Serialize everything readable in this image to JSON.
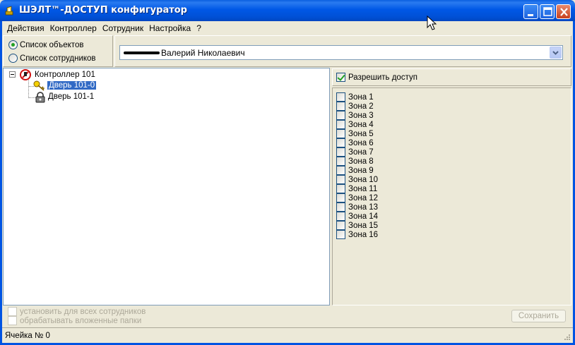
{
  "window": {
    "title": "ШЭЛТ™-ДОСТУП конфигуратор",
    "app_icon": "key-app-icon",
    "buttons": [
      "minimize-icon",
      "maximize-icon",
      "close-icon"
    ]
  },
  "menu": [
    "Действия",
    "Контроллер",
    "Сотрудник",
    "Настройка",
    "?"
  ],
  "view_mode": {
    "options": [
      {
        "label": "Список объектов",
        "checked": true
      },
      {
        "label": "Список сотрудников",
        "checked": false
      }
    ]
  },
  "employee": {
    "selected": "Валерий Николаевич"
  },
  "tree": {
    "root": {
      "label": "Контроллер 101",
      "icon": "controller-icon"
    },
    "children": [
      {
        "label": "Дверь 101-0",
        "icon": "key-icon",
        "selected": true
      },
      {
        "label": "Дверь 101-1",
        "icon": "lock-icon",
        "selected": false
      }
    ]
  },
  "access": {
    "allow_label": "Разрешить доступ",
    "allow_checked": true,
    "zones": [
      "Зона 1",
      "Зона 2",
      "Зона 3",
      "Зона 4",
      "Зона 5",
      "Зона 6",
      "Зона 7",
      "Зона 8",
      "Зона 9",
      "Зона 10",
      "Зона 11",
      "Зона 12",
      "Зона 13",
      "Зона 14",
      "Зона 15",
      "Зона 16"
    ]
  },
  "options": {
    "apply_all": "установить для всех сотрудников",
    "process_nested": "обрабатывать вложенные папки",
    "save": "Сохранить"
  },
  "status": {
    "cell": "Ячейка № 0"
  },
  "colors": {
    "titlebar": "#0054E3",
    "selection": "#316AC5",
    "check": "#21A121",
    "face": "#ECE9D8"
  }
}
